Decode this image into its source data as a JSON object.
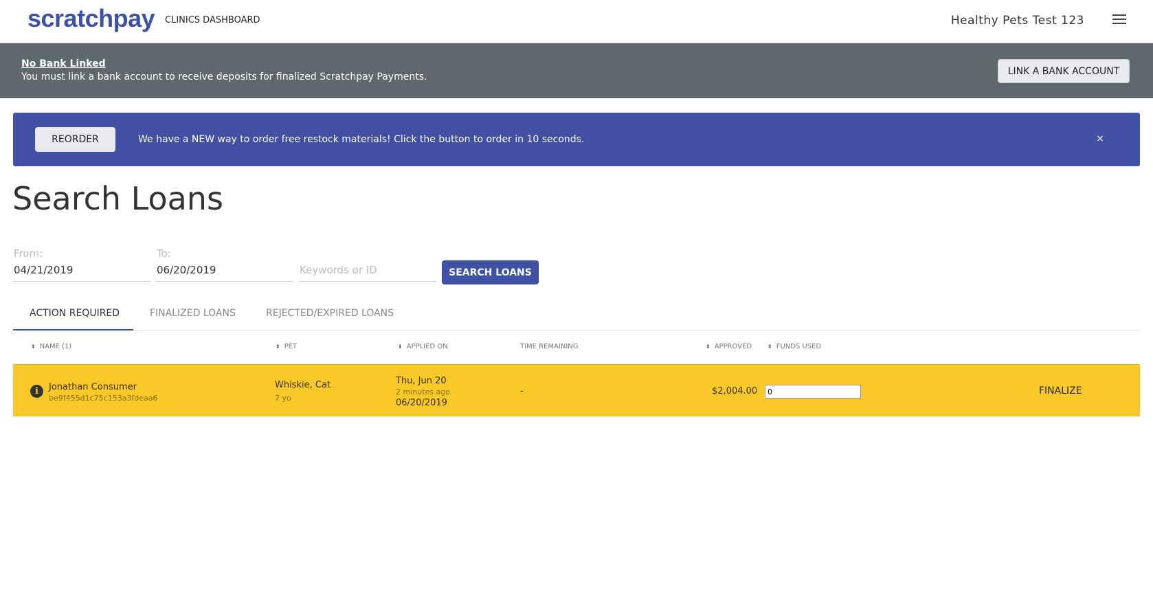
{
  "header": {
    "logo": "scratchpay",
    "subtitle": "CLINICS DASHBOARD",
    "account_name": "Healthy Pets Test 123",
    "menu_icon": "hamburger-menu-icon"
  },
  "bank_banner": {
    "title": "No Bank Linked",
    "message": "You must link a bank account to receive deposits for finalized Scratchpay Payments.",
    "button_label": "LINK A BANK ACCOUNT"
  },
  "promo": {
    "button_label": "REORDER",
    "message": "We have a NEW way to order free restock materials! Click the button to order in 10 seconds.",
    "close": "×"
  },
  "page": {
    "title": "Search Loans"
  },
  "filters": {
    "from_label": "From:",
    "from_value": "04/21/2019",
    "to_label": "To:",
    "to_value": "06/20/2019",
    "keywords_placeholder": "Keywords or ID",
    "search_button": "SEARCH LOANS"
  },
  "tabs": [
    {
      "label": "ACTION REQUIRED",
      "active": true
    },
    {
      "label": "FINALIZED LOANS",
      "active": false
    },
    {
      "label": "REJECTED/EXPIRED LOANS",
      "active": false
    }
  ],
  "table": {
    "columns": {
      "name": "NAME (1)",
      "pet": "PET",
      "applied_on": "APPLIED ON",
      "time_remaining": "TIME REMAINING",
      "approved": "APPROVED",
      "funds_used": "FUNDS USED"
    },
    "sort_glyph": "⬍",
    "rows": [
      {
        "name": "Jonathan Consumer",
        "id": "be9f455d1c75c153a3fdeaa6",
        "pet": "Whiskie, Cat",
        "pet_age": "7 yo",
        "applied_day": "Thu, Jun 20",
        "applied_relative": "2 minutes ago",
        "applied_date": "06/20/2019",
        "time_remaining": "-",
        "approved": "$2,004.00",
        "funds_used": "0",
        "action": "FINALIZE",
        "status_icon": "info-icon",
        "row_color": "#f9c929"
      }
    ]
  },
  "colors": {
    "brand": "#3f51a5",
    "banner_gray": "#5e686d",
    "promo_blue": "#4150a3",
    "action_yellow": "#f9c929"
  }
}
